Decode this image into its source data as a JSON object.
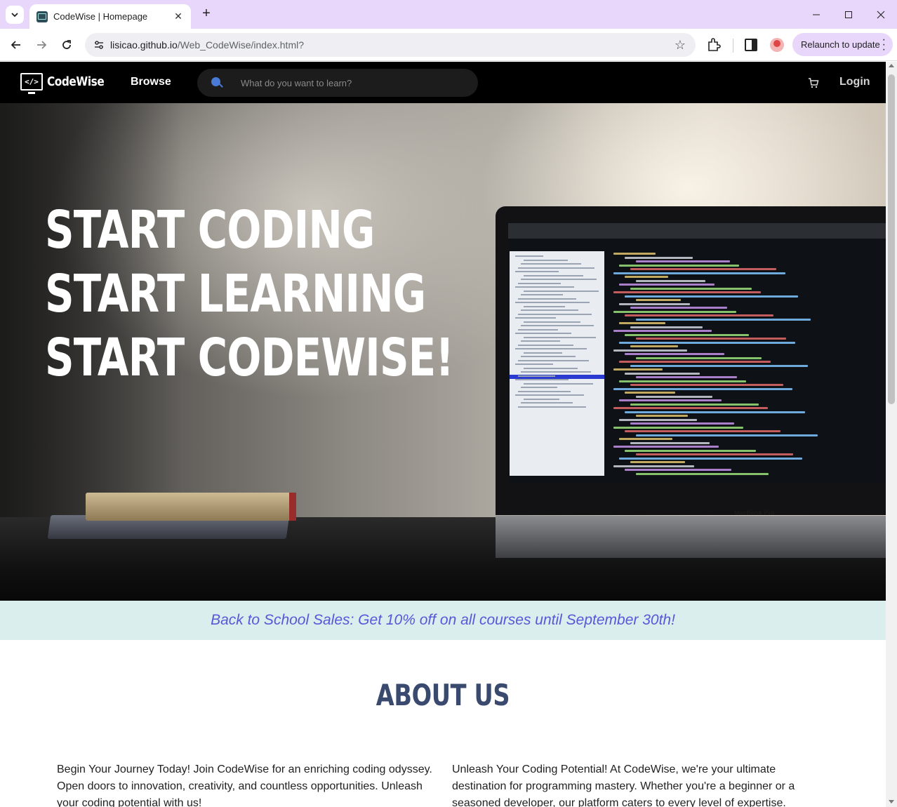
{
  "browser": {
    "tab_title": "CodeWise | Homepage",
    "url_host": "lisicao.github.io",
    "url_path": "/Web_CodeWise/index.html?",
    "relaunch_label": "Relaunch to update",
    "icons": [
      "tab-search-icon",
      "close-icon",
      "plus-icon",
      "minimize-icon",
      "maximize-icon",
      "back-arrow-icon",
      "forward-arrow-icon",
      "reload-icon",
      "site-info-icon",
      "star-icon",
      "extensions-icon",
      "side-panel-icon",
      "profile-avatar",
      "kebab-menu-icon"
    ]
  },
  "nav": {
    "logo_text": "CodeWise",
    "browse_label": "Browse",
    "search_placeholder": "What do you want to learn?",
    "login_label": "Login"
  },
  "hero": {
    "lines": [
      "START CODING",
      "START LEARNING",
      "START CODEWISE!"
    ],
    "laptop_label": "MacBook Pro"
  },
  "promo": {
    "text": "Back to School Sales: Get 10% off on all courses until September 30th!"
  },
  "about": {
    "title": "ABOUT US",
    "left_text": "Begin Your Journey Today! Join CodeWise for an enriching coding odyssey. Open doors to innovation, creativity, and countless opportunities. Unleash your coding potential with us!",
    "right_text": "Unleash Your Coding Potential! At CodeWise, we're your ultimate destination for programming mastery. Whether you're a beginner or a seasoned developer, our platform caters to every level of expertise."
  },
  "colors": {
    "tabstrip": "#e8d7fa",
    "nav_bg": "#000000",
    "promo_bg": "#daeeee",
    "promo_text": "#5a56d9",
    "about_title": "#3a4a6e"
  }
}
